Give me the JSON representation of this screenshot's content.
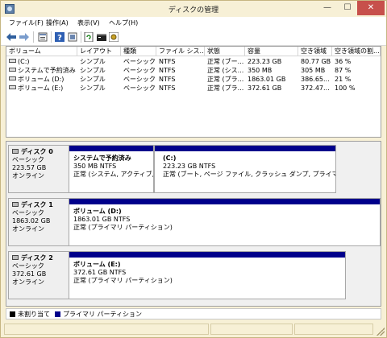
{
  "window": {
    "title": "ディスクの管理",
    "minimize_glyph": "—",
    "maximize_glyph": "☐",
    "close_glyph": "✕"
  },
  "menu": {
    "items": [
      {
        "label": "ファイル(F)"
      },
      {
        "label": "操作(A)"
      },
      {
        "label": "表示(V)"
      },
      {
        "label": "ヘルプ(H)"
      }
    ]
  },
  "toolbar": {
    "icons": [
      "back-arrow-icon",
      "forward-arrow-icon",
      "properties-icon",
      "help-icon",
      "disk-list-icon",
      "refresh-icon",
      "command-prompt-icon",
      "settings-icon"
    ]
  },
  "volume_list": {
    "columns": [
      "ボリューム",
      "レイアウト",
      "種類",
      "ファイル シス...",
      "状態",
      "容量",
      "空き領域",
      "空き領域の割..."
    ],
    "rows": [
      {
        "volume": "(C:)",
        "layout": "シンプル",
        "type": "ベーシック",
        "fs": "NTFS",
        "status": "正常 (ブー...",
        "capacity": "223.23 GB",
        "free": "80.77 GB",
        "pct": "36 %"
      },
      {
        "volume": "システムで予約済み",
        "layout": "シンプル",
        "type": "ベーシック",
        "fs": "NTFS",
        "status": "正常 (シス...",
        "capacity": "350 MB",
        "free": "305 MB",
        "pct": "87 %"
      },
      {
        "volume": "ボリューム (D:)",
        "layout": "シンプル",
        "type": "ベーシック",
        "fs": "NTFS",
        "status": "正常 (プラ...",
        "capacity": "1863.01 GB",
        "free": "386.65...",
        "pct": "21 %"
      },
      {
        "volume": "ボリューム (E:)",
        "layout": "シンプル",
        "type": "ベーシック",
        "fs": "NTFS",
        "status": "正常 (プラ...",
        "capacity": "372.61 GB",
        "free": "372.47...",
        "pct": "100 %"
      }
    ]
  },
  "disks": [
    {
      "name": "ディスク 0",
      "type": "ベーシック",
      "size": "223.57 GB",
      "state": "オンライン",
      "partitions": [
        {
          "name": "システムで予約済み",
          "size": "350 MB NTFS",
          "status": "正常 (システム, アクティブ, プラ"
        },
        {
          "name": "(C:)",
          "size": "223.23 GB NTFS",
          "status": "正常 (ブート, ページ ファイル, クラッシュ ダンプ, プライマリ パーティショ"
        }
      ]
    },
    {
      "name": "ディスク 1",
      "type": "ベーシック",
      "size": "1863.02 GB",
      "state": "オンライン",
      "partitions": [
        {
          "name": "ボリューム (D:)",
          "size": "1863.01 GB NTFS",
          "status": "正常 (プライマリ パーティション)"
        }
      ]
    },
    {
      "name": "ディスク 2",
      "type": "ベーシック",
      "size": "372.61 GB",
      "state": "オンライン",
      "partitions": [
        {
          "name": "ボリューム (E:)",
          "size": "372.61 GB NTFS",
          "status": "正常 (プライマリ パーティション)"
        }
      ]
    }
  ],
  "legend": {
    "unallocated": {
      "label": "未割り当て",
      "color": "#000000"
    },
    "primary": {
      "label": "プライマリ パーティション",
      "color": "#00008b"
    }
  }
}
